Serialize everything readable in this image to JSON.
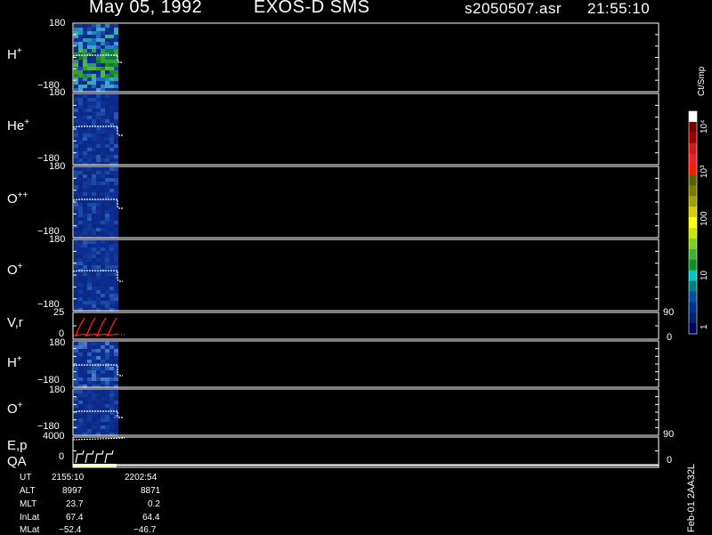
{
  "header": {
    "date": "May 05, 1992",
    "instrument": "EXOS-D SMS",
    "file": "s2050507.asr",
    "time": "21:55:10"
  },
  "panels": [
    {
      "label": "H",
      "sup": "+",
      "top_tick": "180",
      "bottom_tick": "−180"
    },
    {
      "label": "He",
      "sup": "+",
      "top_tick": "180",
      "bottom_tick": "−180"
    },
    {
      "label": "O",
      "sup": "++",
      "top_tick": "180",
      "bottom_tick": "−180"
    },
    {
      "label": "O",
      "sup": "+",
      "top_tick": "180",
      "bottom_tick": "−180"
    },
    {
      "label": "V,r",
      "sup": "",
      "top_tick": "25",
      "bottom_tick": "0",
      "right_top": "90",
      "right_bottom": "0"
    },
    {
      "label": "H",
      "sup": "+",
      "top_tick": "180",
      "bottom_tick": "−180"
    },
    {
      "label": "O",
      "sup": "+",
      "top_tick": "180",
      "bottom_tick": "−180"
    },
    {
      "label": "E,p",
      "sup": "",
      "top_tick": "4000",
      "bottom_tick": "0",
      "right_top": "90",
      "right_bottom": "0"
    },
    {
      "label": "QA",
      "sup": "",
      "top_tick": "",
      "bottom_tick": ""
    }
  ],
  "colorbar": {
    "unit": "Ct/Smp",
    "labels": [
      "10⁴",
      "10³",
      "100",
      "10",
      "1"
    ],
    "colors": [
      "#ffffff",
      "#7a0000",
      "#a00000",
      "#cc1a1a",
      "#ee2020",
      "#ff1a00",
      "#5a6000",
      "#7a7a00",
      "#a0a000",
      "#d0d000",
      "#ffff00",
      "#c8e800",
      "#80d020",
      "#40b030",
      "#109020",
      "#00c8c8",
      "#008080",
      "#0050a0",
      "#003090",
      "#002070",
      "#000060"
    ]
  },
  "stamp": "Feb-01 2AA32L",
  "orbit_table": {
    "rows": [
      {
        "name": "UT",
        "v1": "2155:10",
        "v2": "2202:54"
      },
      {
        "name": "ALT",
        "v1": "8997",
        "v2": "8871"
      },
      {
        "name": "MLT",
        "v1": "23.7",
        "v2": "0.2"
      },
      {
        "name": "InLat",
        "v1": "67.4",
        "v2": "64.4"
      },
      {
        "name": "MLat",
        "v1": "−52.4",
        "v2": "−46.7"
      }
    ]
  },
  "chart_data": {
    "type": "heatmap",
    "title": "May 05, 1992   EXOS-D SMS",
    "panels": [
      {
        "name": "H+",
        "ylim": [
          -180,
          180
        ]
      },
      {
        "name": "He+",
        "ylim": [
          -180,
          180
        ]
      },
      {
        "name": "O++",
        "ylim": [
          -180,
          180
        ]
      },
      {
        "name": "O+",
        "ylim": [
          -180,
          180
        ]
      },
      {
        "name": "V,r",
        "ylim": [
          0,
          25
        ],
        "right_ylim": [
          0,
          90
        ]
      },
      {
        "name": "H+",
        "ylim": [
          -180,
          180
        ]
      },
      {
        "name": "O+",
        "ylim": [
          -180,
          180
        ]
      },
      {
        "name": "E,p",
        "ylim": [
          0,
          4000
        ],
        "right_ylim": [
          0,
          90
        ]
      },
      {
        "name": "QA"
      }
    ],
    "x_range": [
      "2155:10",
      "2202:54"
    ],
    "colorbar_unit": "Ct/Smp",
    "colorbar_ticks": [
      "1",
      "10",
      "100",
      "10^3",
      "10^4"
    ]
  }
}
